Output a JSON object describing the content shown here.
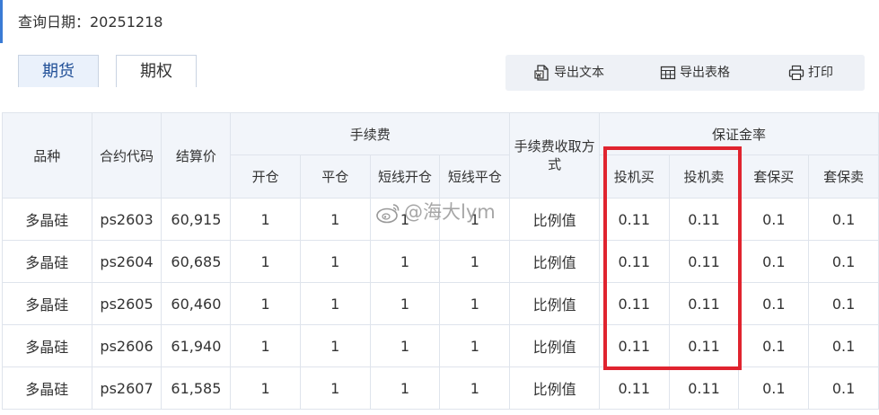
{
  "query": {
    "label": "查询日期：20251218"
  },
  "tabs": [
    {
      "label": "期货",
      "active": true
    },
    {
      "label": "期权",
      "active": false
    }
  ],
  "toolbar": {
    "export_text": "导出文本",
    "export_table": "导出表格",
    "print": "打印"
  },
  "table": {
    "headers": {
      "variety": "品种",
      "contract": "合约代码",
      "settlement": "结算价",
      "fee_group": "手续费",
      "fee_method": "手续费收取方式",
      "margin_group": "保证金率",
      "fee_cols": [
        "开仓",
        "平仓",
        "短线开仓",
        "短线平仓"
      ],
      "margin_cols": [
        "投机买",
        "投机卖",
        "套保买",
        "套保卖"
      ]
    },
    "rows": [
      [
        "多晶硅",
        "ps2603",
        "60,915",
        "1",
        "1",
        "1",
        "1",
        "比例值",
        "0.11",
        "0.11",
        "0.1",
        "0.1"
      ],
      [
        "多晶硅",
        "ps2604",
        "60,685",
        "1",
        "1",
        "1",
        "1",
        "比例值",
        "0.11",
        "0.11",
        "0.1",
        "0.1"
      ],
      [
        "多晶硅",
        "ps2605",
        "60,460",
        "1",
        "1",
        "1",
        "1",
        "比例值",
        "0.11",
        "0.11",
        "0.1",
        "0.1"
      ],
      [
        "多晶硅",
        "ps2606",
        "61,940",
        "1",
        "1",
        "1",
        "1",
        "比例值",
        "0.11",
        "0.11",
        "0.1",
        "0.1"
      ],
      [
        "多晶硅",
        "ps2607",
        "61,585",
        "1",
        "1",
        "1",
        "1",
        "比例值",
        "0.11",
        "0.11",
        "0.1",
        "0.1"
      ]
    ]
  },
  "watermark": {
    "text": "@海大lym"
  },
  "colors": {
    "accent": "#3a7bd5",
    "highlight": "#e0242f",
    "header_bg": "#f2f5fa"
  }
}
